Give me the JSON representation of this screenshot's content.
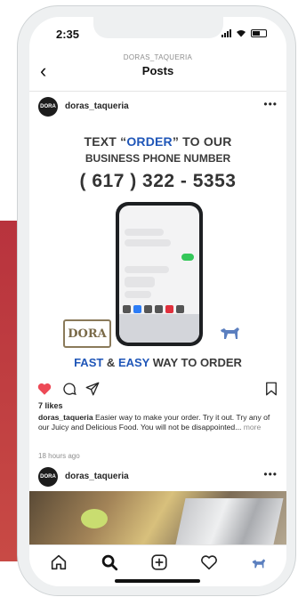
{
  "status_bar": {
    "time": "2:35"
  },
  "header": {
    "account": "DORAS_TAQUERIA",
    "title": "Posts",
    "back_icon": "chevron-left-icon"
  },
  "post": {
    "username": "doras_taqueria",
    "avatar_text": "DORA",
    "image": {
      "headline_pre": "TEXT “",
      "headline_accent": "ORDER",
      "headline_post": "” TO OUR",
      "subheadline": "BUSINESS PHONE NUMBER",
      "phone_number": "( 617 ) 322 - 5353",
      "logo_text": "DORA",
      "tagline_accent_1": "FAST",
      "tagline_mid": " & ",
      "tagline_accent_2": "EASY",
      "tagline_post": " WAY TO ORDER"
    },
    "likes": "7 likes",
    "caption_user": "doras_taqueria",
    "caption_text": " Easier way to make your order.  Try it out. Try any of our Juicy and Delicious Food. You will not be disappointed...",
    "caption_more": " more",
    "timestamp": "18 hours ago",
    "liked": true,
    "colors": {
      "like": "#ed4956",
      "accent": "#1f56b8"
    }
  },
  "post2": {
    "username": "doras_taqueria",
    "avatar_text": "DORA"
  },
  "tabbar": {
    "items": [
      "home-icon",
      "search-icon",
      "new-post-icon",
      "activity-heart-icon",
      "profile-icon"
    ],
    "active": "search-icon"
  }
}
